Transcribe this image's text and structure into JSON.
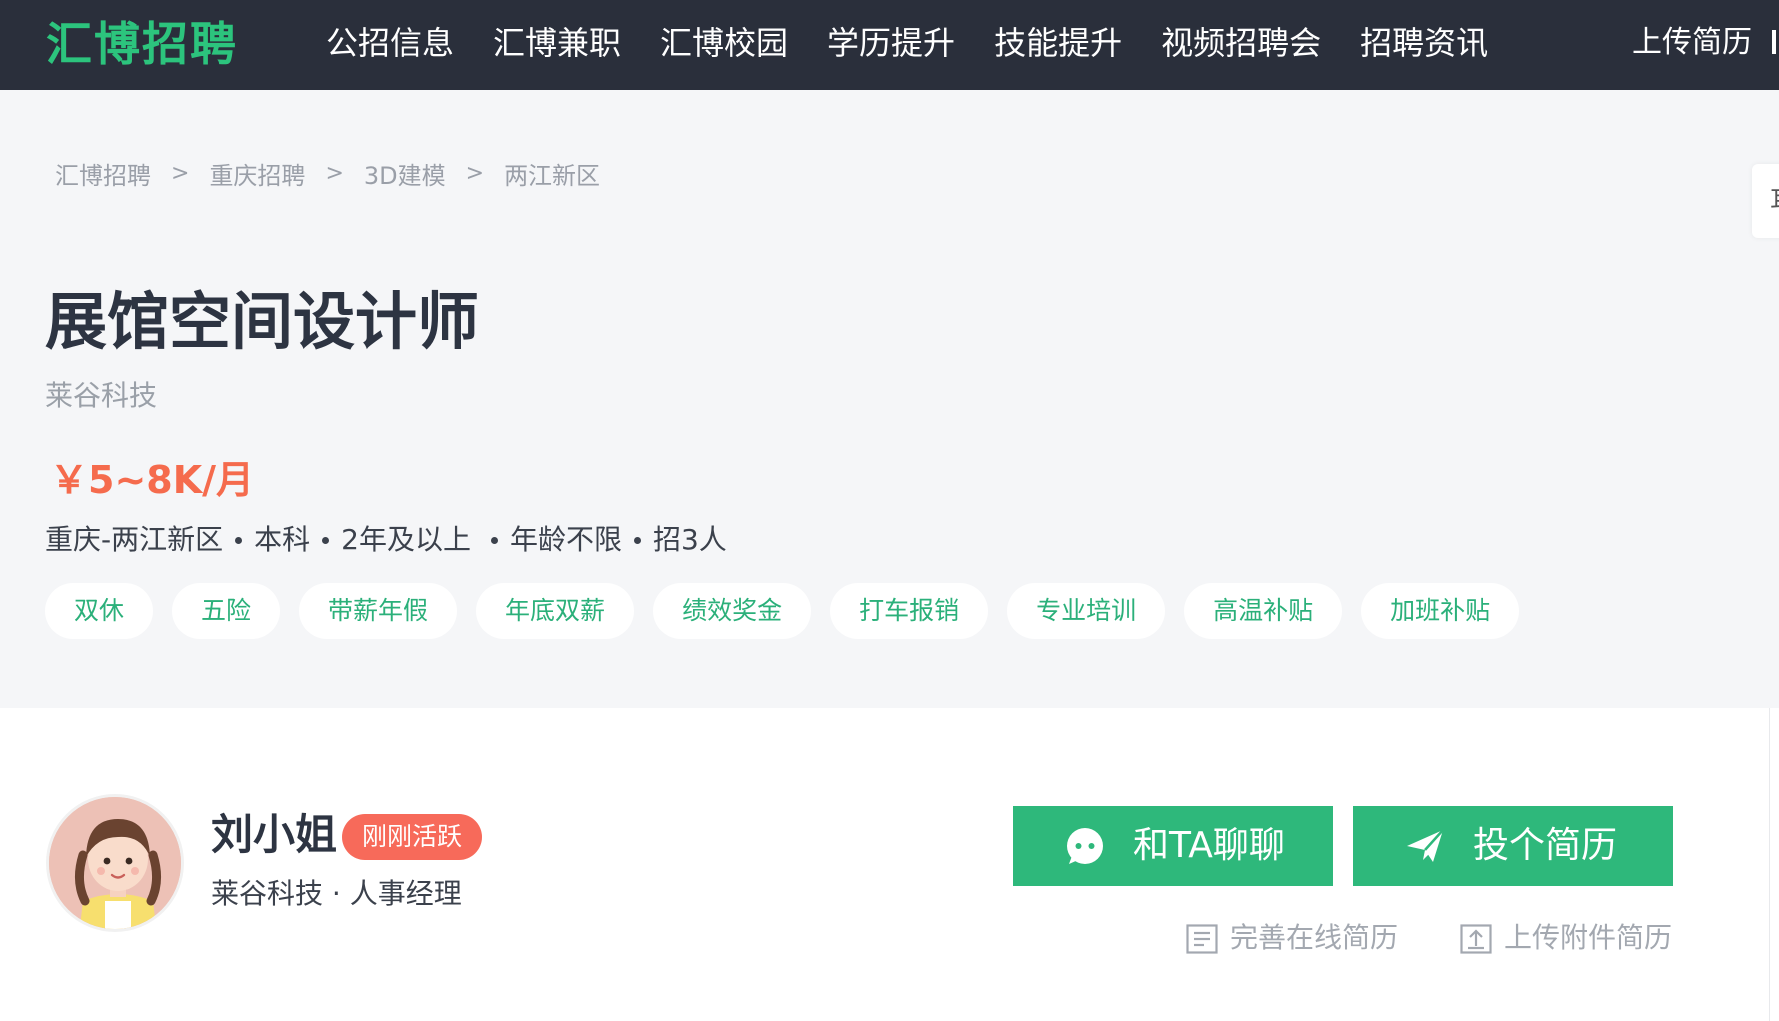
{
  "header": {
    "logo": "汇博招聘",
    "nav": [
      "公招信息",
      "汇博兼职",
      "汇博校园",
      "学历提升",
      "技能提升",
      "视频招聘会",
      "招聘资讯"
    ],
    "upload_resume": "上传简历"
  },
  "breadcrumb": [
    "汇博招聘",
    "重庆招聘",
    "3D建模",
    "两江新区"
  ],
  "breadcrumb_separator": ">",
  "side_tab_text": "耳",
  "job": {
    "title": "展馆空间设计师",
    "company": "莱谷科技",
    "salary": "￥5~8K/月",
    "meta": [
      "重庆-两江新区",
      "本科",
      "2年及以上",
      "年龄不限",
      "招3人"
    ],
    "benefits": [
      "双休",
      "五险",
      "带薪年假",
      "年底双薪",
      "绩效奖金",
      "打车报销",
      "专业培训",
      "高温补贴",
      "加班补贴"
    ]
  },
  "recruiter": {
    "name": "刘小姐",
    "status_badge": "刚刚活跃",
    "role": "莱谷科技 · 人事经理",
    "avatar_icon": "avatar-girl-icon"
  },
  "actions": {
    "chat_label": "和TA聊聊",
    "apply_label": "投个简历",
    "complete_online_resume": "完善在线简历",
    "upload_attachment_resume": "上传附件简历"
  },
  "colors": {
    "brand_green": "#2eb87b",
    "salary_red": "#f56b4d",
    "badge_red": "#f76a5a",
    "topbar_dark": "#2a2f3b"
  }
}
